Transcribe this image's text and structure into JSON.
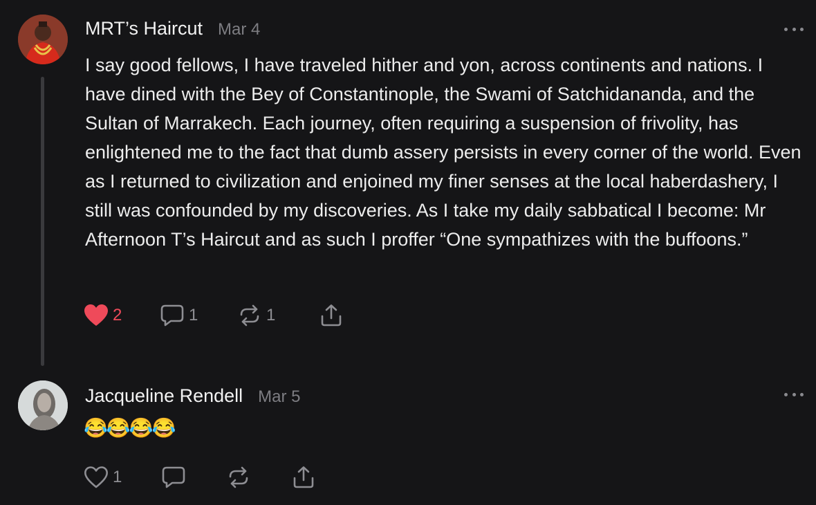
{
  "comments": [
    {
      "author": "MRT’s Haircut",
      "date": "Mar 4",
      "text": "I say good fellows, I have traveled hither and yon, across continents and nations. I have dined with the Bey of Constantinople, the Swami of Satchidananda, and the Sultan of Marrakech. Each journey, often requiring a suspension of frivolity, has enlightened me to the fact that dumb assery persists in every corner of the world. Even as I returned to civilization and enjoined my finer senses at the local haberdashery, I still was confounded by my discoveries. As I take my daily sabbatical I become: Mr Afternoon T’s Haircut and as such I proffer “One sympathizes with the buffoons.”",
      "likes": "2",
      "liked": true,
      "replies": "1",
      "restacks": "1",
      "icons": {
        "like": "heart-filled-icon",
        "reply": "speech-bubble-icon",
        "restack": "restack-arrows-icon",
        "share": "share-upload-icon",
        "more": "ellipsis-icon"
      },
      "colors": {
        "like_active": "#ef4a5a"
      }
    },
    {
      "author": "Jacqueline Rendell",
      "date": "Mar 5",
      "text": "😂😂😂😂",
      "likes": "1",
      "liked": false,
      "replies": "",
      "restacks": "",
      "icons": {
        "like": "heart-outline-icon",
        "reply": "speech-bubble-icon",
        "restack": "restack-arrows-icon",
        "share": "share-upload-icon",
        "more": "ellipsis-icon"
      }
    }
  ],
  "colors": {
    "background": "#151517",
    "text": "#ededed",
    "muted": "#8e8e93",
    "thread_line": "#3a3a3d"
  }
}
